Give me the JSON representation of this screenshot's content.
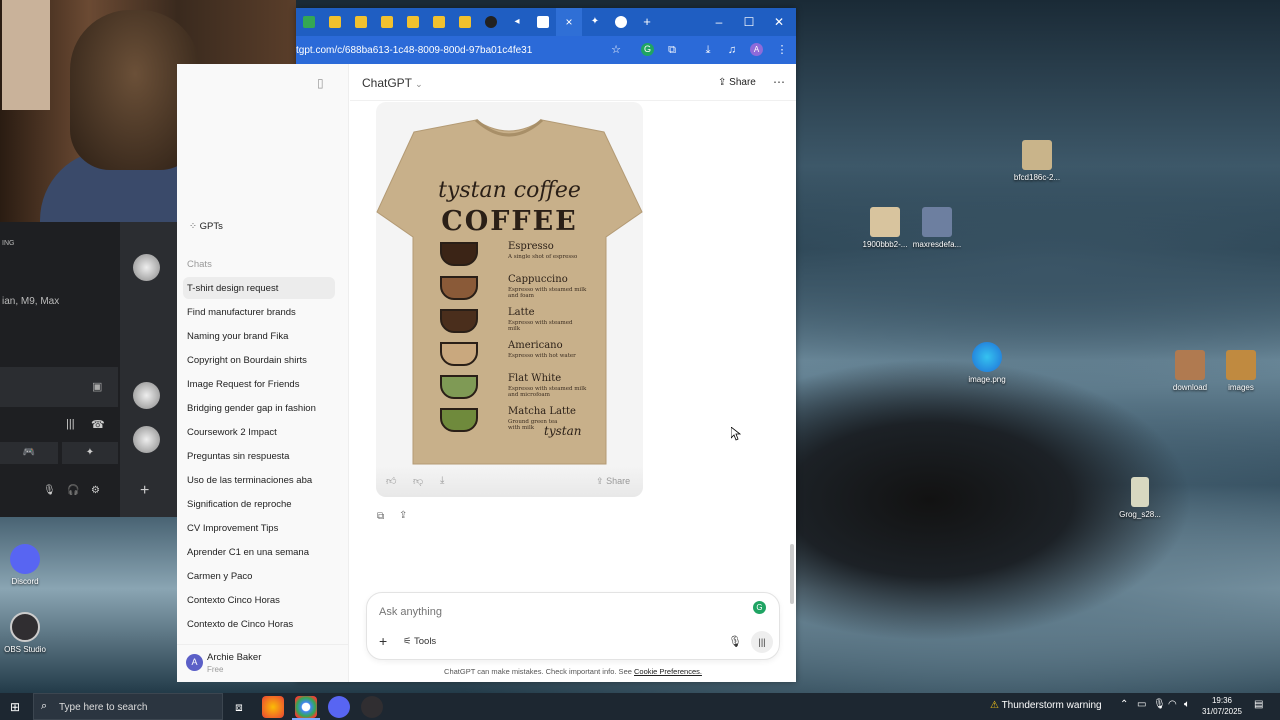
{
  "browser": {
    "url": "tgpt.com/c/688ba613-1c48-8009-800d-97ba01c4fe31",
    "active_tab_close": "×",
    "new_tab": "+",
    "win_min": "–",
    "win_max": "☐",
    "win_close": "✕",
    "profile_initial": "A"
  },
  "chatgpt": {
    "header_title": "ChatGPT",
    "share_label": "Share",
    "sidebar": {
      "gpts_label": "GPTs",
      "chats_heading": "Chats",
      "chats": [
        "T-shirt design request",
        "Find manufacturer brands",
        "Naming your brand Fika",
        "Copyright on Bourdain shirts",
        "Image Request for Friends",
        "Bridging gender gap in fashion",
        "Coursework 2 Impact",
        "Preguntas sin respuesta",
        "Uso de las terminaciones aba",
        "Signification de reproche",
        "CV Improvement Tips",
        "Aprender C1 en una semana",
        "Carmen y Paco",
        "Contexto Cinco Horas",
        "Contexto de Cinco Horas"
      ],
      "user_name": "Archie Baker",
      "user_plan": "Free",
      "user_initial": "A"
    },
    "image": {
      "script_title": "tystan coffee",
      "big_title": "COFFEE",
      "items": [
        {
          "name": "Espresso",
          "desc": "A single shot of espresso",
          "color": "#3b2416"
        },
        {
          "name": "Cappuccino",
          "desc": "Espresso with steamed milk and foam",
          "color": "#8a5a38"
        },
        {
          "name": "Latte",
          "desc": "Espresso with steamed milk",
          "color": "#4a2e1c"
        },
        {
          "name": "Americano",
          "desc": "Espresso with hot water",
          "color": "#c9a87e"
        },
        {
          "name": "Flat White",
          "desc": "Espresso with steamed milk and microfoam",
          "color": "#7f9a55"
        },
        {
          "name": "Matcha Latte",
          "desc": "Ground green tea with milk",
          "color": "#6f8a3c"
        }
      ],
      "signature": "tystan",
      "share_label": "Share"
    },
    "composer": {
      "placeholder": "Ask anything",
      "tools_label": "Tools"
    },
    "disclaimer": "ChatGPT can make mistakes. Check important info. See",
    "disclaimer_link": "Cookie Preferences."
  },
  "discord": {
    "label_live": "ING",
    "label_models": "ian, M9, Max"
  },
  "desktop": {
    "icons": [
      {
        "label": "bfcd186c-2...",
        "color": "#c9b48a"
      },
      {
        "label": "1900bbb2-...",
        "color": "#d8c49e"
      },
      {
        "label": "maxresdefa...",
        "color": "#6d7fa0"
      },
      {
        "label": "image.png",
        "color": "#1e88d6"
      },
      {
        "label": "download",
        "color": "#b07a50"
      },
      {
        "label": "images",
        "color": "#c08a40"
      },
      {
        "label": "Grog_s28...",
        "color": "#d8d8c0"
      },
      {
        "label": "Discord",
        "color": "#5865f2"
      },
      {
        "label": "OBS Studio",
        "color": "#302e31"
      },
      {
        "label": "Firefox",
        "color": "#ff7139"
      }
    ]
  },
  "taskbar": {
    "search_placeholder": "Type here to search",
    "weather": "Thunderstorm warning",
    "time": "19:36",
    "date": "31/07/2025"
  }
}
